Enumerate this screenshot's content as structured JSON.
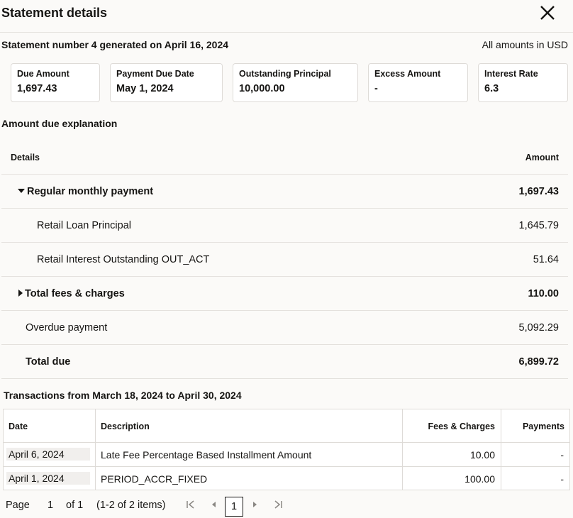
{
  "header": {
    "title": "Statement details"
  },
  "statement": {
    "subtitle": "Statement number 4 generated on April 16, 2024",
    "units_note": "All amounts in USD"
  },
  "summary_cards": [
    {
      "label": "Due Amount",
      "value": "1,697.43"
    },
    {
      "label": "Payment Due Date",
      "value": "May 1, 2024"
    },
    {
      "label": "Outstanding Principal",
      "value": "10,000.00"
    },
    {
      "label": "Excess Amount",
      "value": "-"
    },
    {
      "label": "Interest Rate",
      "value": "6.3"
    }
  ],
  "explanation": {
    "title": "Amount due explanation",
    "col_details": "Details",
    "col_amount": "Amount",
    "rows": [
      {
        "label": "Regular monthly payment",
        "amount": "1,697.43"
      },
      {
        "label": "Retail Loan Principal",
        "amount": "1,645.79"
      },
      {
        "label": "Retail Interest Outstanding OUT_ACT",
        "amount": "51.64"
      },
      {
        "label": "Total fees & charges",
        "amount": "110.00"
      },
      {
        "label": "Overdue payment",
        "amount": "5,092.29"
      },
      {
        "label": "Total due",
        "amount": "6,899.72"
      }
    ]
  },
  "transactions": {
    "title": "Transactions from March 18, 2024 to April 30, 2024",
    "columns": [
      "Date",
      "Description",
      "Fees & Charges",
      "Payments"
    ],
    "rows": [
      {
        "date": "April 6, 2024",
        "description": "Late Fee Percentage Based Installment Amount",
        "fees": "10.00",
        "payments": "-"
      },
      {
        "date": "April 1, 2024",
        "description": "PERIOD_ACCR_FIXED",
        "fees": "100.00",
        "payments": "-"
      }
    ]
  },
  "pagination": {
    "page_label": "Page",
    "page_value": "1",
    "of_label": "of 1",
    "items_label": "(1-2 of 2 items)",
    "current_page": "1"
  }
}
